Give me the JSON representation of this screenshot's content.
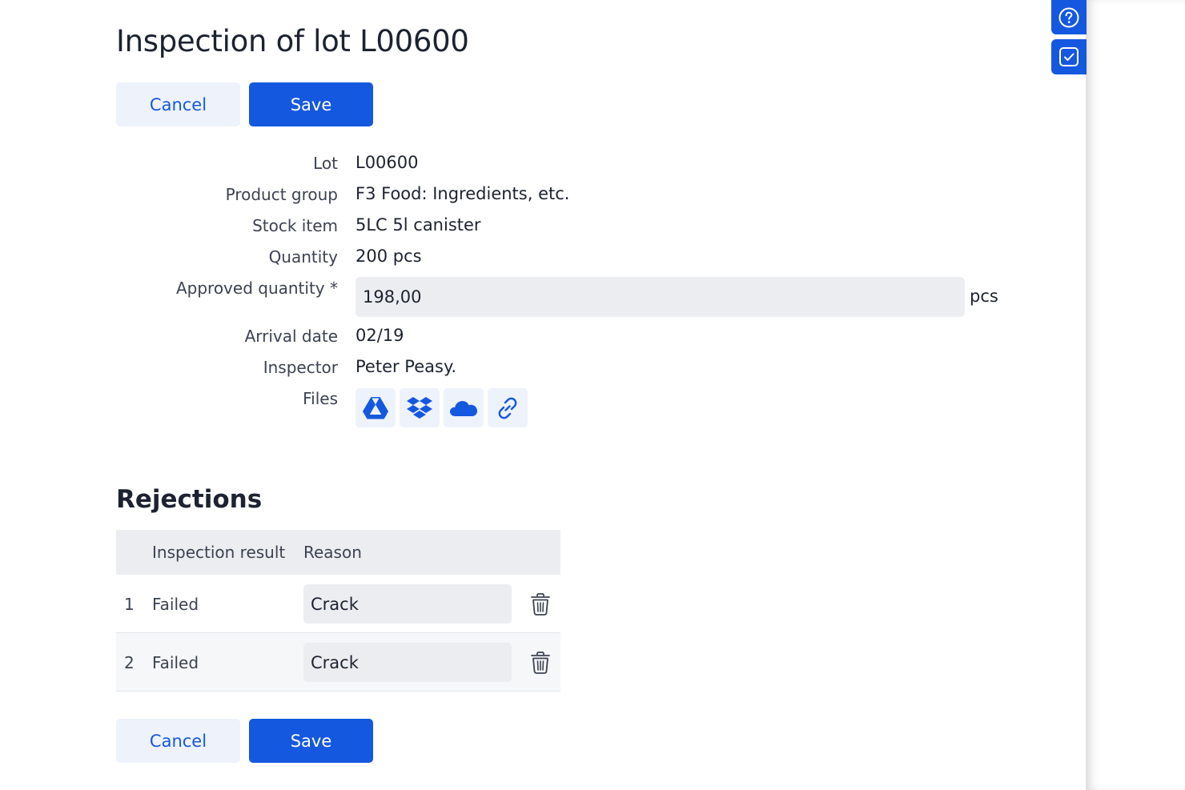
{
  "page": {
    "title": "Inspection of lot L00600"
  },
  "actions": {
    "cancel_label": "Cancel",
    "save_label": "Save"
  },
  "form": {
    "lot": {
      "label": "Lot",
      "value": "L00600"
    },
    "product_group": {
      "label": "Product group",
      "value": "F3 Food: Ingredients, etc."
    },
    "stock_item": {
      "label": "Stock item",
      "value": "5LC 5l canister"
    },
    "quantity": {
      "label": "Quantity",
      "value": "200 pcs"
    },
    "approved_quantity": {
      "label": "Approved quantity *",
      "value": "198,00",
      "unit": "pcs"
    },
    "arrival_date": {
      "label": "Arrival date",
      "value": "02/19"
    },
    "inspector": {
      "label": "Inspector",
      "value": "Peter Peasy."
    },
    "files": {
      "label": "Files",
      "icons": [
        "google-drive-icon",
        "dropbox-icon",
        "onedrive-icon",
        "link-icon"
      ]
    }
  },
  "rejections": {
    "title": "Rejections",
    "columns": [
      "Inspection result",
      "Reason"
    ],
    "rows": [
      {
        "num": "1",
        "result": "Failed",
        "reason": "Crack"
      },
      {
        "num": "2",
        "result": "Failed",
        "reason": "Crack"
      }
    ]
  },
  "side_panel": {
    "icons": [
      "help-icon",
      "tasks-icon"
    ]
  },
  "colors": {
    "accent": "#1558e0",
    "button_secondary_bg": "#eef2fb",
    "input_bg": "#ebedf0",
    "text": "#1c2230",
    "label": "#3b4252"
  }
}
